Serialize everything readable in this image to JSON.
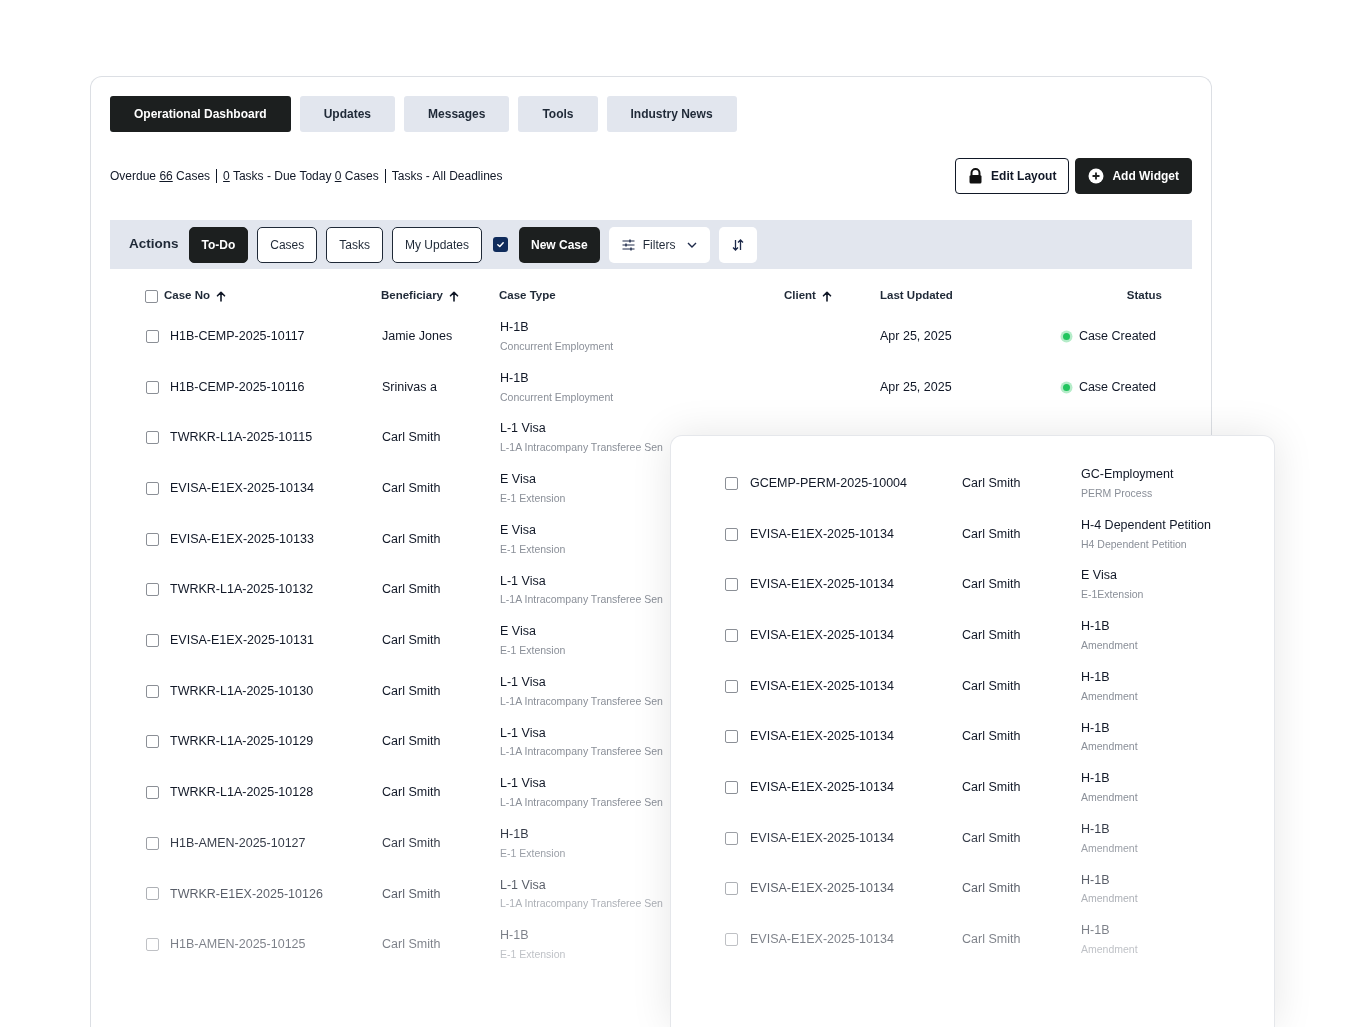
{
  "tabs": [
    {
      "label": "Operational Dashboard",
      "selected": true
    },
    {
      "label": "Updates",
      "selected": false
    },
    {
      "label": "Messages",
      "selected": false
    },
    {
      "label": "Tools",
      "selected": false
    },
    {
      "label": "Industry News",
      "selected": false
    }
  ],
  "summary": [
    [
      {
        "text": "Overdue",
        "link": false
      },
      {
        "text": "66",
        "link": true
      },
      {
        "text": "Cases",
        "link": false
      }
    ],
    [
      {
        "text": "0",
        "link": true
      },
      {
        "text": "Tasks - Due Today",
        "link": false
      },
      {
        "text": "0",
        "link": true
      },
      {
        "text": "Cases",
        "link": false
      }
    ],
    [
      {
        "text": "Tasks - All Deadlines",
        "link": false
      }
    ]
  ],
  "header_buttons": [
    {
      "kind": "lock",
      "label": "Edit Layout",
      "primary": false
    },
    {
      "kind": "plus",
      "label": "Add Widget",
      "primary": true
    }
  ],
  "actions": {
    "label": "Actions",
    "filters": [
      {
        "label": "To-Do",
        "selected": true
      },
      {
        "label": "Cases",
        "selected": false
      },
      {
        "label": "Tasks",
        "selected": false
      },
      {
        "label": "My Updates",
        "selected": false
      }
    ],
    "checked": true,
    "new_case": "New Case",
    "filters_button": "Filters"
  },
  "table": {
    "all_checked": false,
    "columns": [
      {
        "label": "Case No",
        "sorted": true
      },
      {
        "label": "Beneficiary",
        "sorted": true
      },
      {
        "label": "Case Type",
        "sorted": false
      },
      {
        "label": "Client",
        "sorted": true
      },
      {
        "label": "Last Updated",
        "sorted": false
      },
      {
        "label": "Status",
        "sorted": false
      }
    ],
    "rows": [
      {
        "case_no": "H1B-CEMP-2025-10117",
        "beneficiary": "Jamie Jones",
        "type": "H-1B",
        "subtype": "Concurrent Employment",
        "updated": "Apr 25, 2025",
        "status": "Case Created",
        "color": "#22c55e",
        "checked": false
      },
      {
        "case_no": "H1B-CEMP-2025-10116",
        "beneficiary": "Srinivas a",
        "type": "H-1B",
        "subtype": "Concurrent Employment",
        "updated": "Apr 25, 2025",
        "status": "Case Created",
        "color": "#22c55e",
        "checked": false
      },
      {
        "case_no": "TWRKR-L1A-2025-10115",
        "beneficiary": "Carl Smith",
        "type": "L-1 Visa",
        "subtype": "L-1A Intracompany Transferee Sen",
        "checked": false
      },
      {
        "case_no": "EVISA-E1EX-2025-10134",
        "beneficiary": "Carl Smith",
        "type": "E Visa",
        "subtype": "E-1 Extension",
        "checked": false
      },
      {
        "case_no": "EVISA-E1EX-2025-10133",
        "beneficiary": "Carl Smith",
        "type": "E Visa",
        "subtype": "E-1 Extension",
        "checked": false
      },
      {
        "case_no": "TWRKR-L1A-2025-10132",
        "beneficiary": "Carl Smith",
        "type": "L-1 Visa",
        "subtype": "L-1A Intracompany Transferee Sen",
        "checked": false
      },
      {
        "case_no": "EVISA-E1EX-2025-10131",
        "beneficiary": "Carl Smith",
        "type": "E Visa",
        "subtype": "E-1 Extension",
        "checked": false
      },
      {
        "case_no": "TWRKR-L1A-2025-10130",
        "beneficiary": "Carl Smith",
        "type": "L-1 Visa",
        "subtype": "L-1A Intracompany Transferee Sen",
        "checked": false
      },
      {
        "case_no": "TWRKR-L1A-2025-10129",
        "beneficiary": "Carl Smith",
        "type": "L-1 Visa",
        "subtype": "L-1A Intracompany Transferee Sen",
        "checked": false
      },
      {
        "case_no": "TWRKR-L1A-2025-10128",
        "beneficiary": "Carl Smith",
        "type": "L-1 Visa",
        "subtype": "L-1A Intracompany Transferee Sen",
        "checked": false
      },
      {
        "case_no": "H1B-AMEN-2025-10127",
        "beneficiary": "Carl Smith",
        "type": "H-1B",
        "subtype": "E-1 Extension",
        "checked": false
      },
      {
        "case_no": "TWRKR-E1EX-2025-10126",
        "beneficiary": "Carl Smith",
        "type": "L-1 Visa",
        "subtype": "L-1A Intracompany Transferee Sen",
        "checked": false
      },
      {
        "case_no": "H1B-AMEN-2025-10125",
        "beneficiary": "Carl Smith",
        "type": "H-1B",
        "subtype": "E-1 Extension",
        "checked": false
      }
    ]
  },
  "panel_rows": [
    {
      "case_no": "GCEMP-PERM-2025-10004",
      "client": "Carl Smith",
      "type": "GC-Employment",
      "subtype": "PERM Process",
      "checked": false
    },
    {
      "case_no": "EVISA-E1EX-2025-10134",
      "client": "Carl Smith",
      "type": "H-4 Dependent Petition",
      "subtype": "H4 Dependent Petition",
      "checked": false
    },
    {
      "case_no": "EVISA-E1EX-2025-10134",
      "client": "Carl Smith",
      "type": "E Visa",
      "subtype": "E-1Extension",
      "checked": false
    },
    {
      "case_no": "EVISA-E1EX-2025-10134",
      "client": "Carl Smith",
      "type": "H-1B",
      "subtype": "Amendment",
      "checked": false
    },
    {
      "case_no": "EVISA-E1EX-2025-10134",
      "client": "Carl Smith",
      "type": "H-1B",
      "subtype": "Amendment",
      "checked": false
    },
    {
      "case_no": "EVISA-E1EX-2025-10134",
      "client": "Carl Smith",
      "type": "H-1B",
      "subtype": "Amendment",
      "checked": false
    },
    {
      "case_no": "EVISA-E1EX-2025-10134",
      "client": "Carl Smith",
      "type": "H-1B",
      "subtype": "Amendment",
      "checked": false
    },
    {
      "case_no": "EVISA-E1EX-2025-10134",
      "client": "Carl Smith",
      "type": "H-1B",
      "subtype": "Amendment",
      "checked": false
    },
    {
      "case_no": "EVISA-E1EX-2025-10134",
      "client": "Carl Smith",
      "type": "H-1B",
      "subtype": "Amendment",
      "checked": false
    },
    {
      "case_no": "EVISA-E1EX-2025-10134",
      "client": "Carl Smith",
      "type": "H-1B",
      "subtype": "Amendment",
      "checked": false
    }
  ]
}
